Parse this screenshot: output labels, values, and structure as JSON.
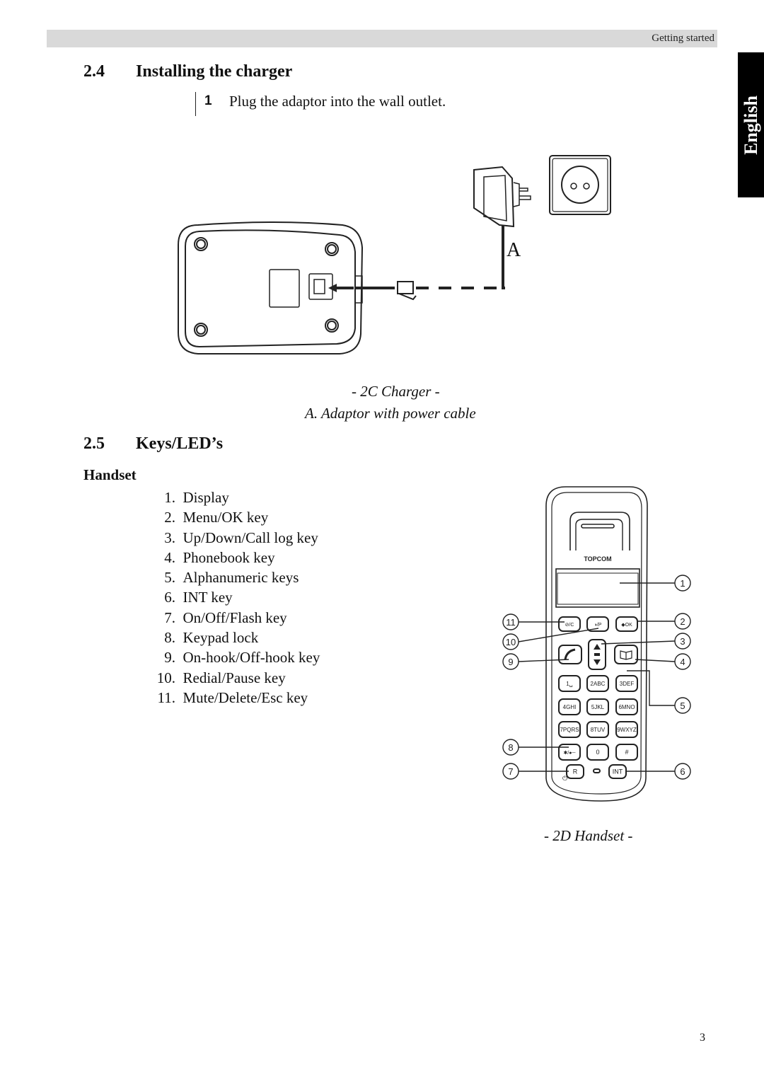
{
  "header": {
    "section_label": "Getting started"
  },
  "language_tab": "English",
  "section_charger": {
    "number": "2.4",
    "title": "Installing the charger",
    "step": {
      "number": "1",
      "text": "Plug the adaptor into the wall outlet."
    },
    "figure": {
      "label_A": "A",
      "caption_title": "- 2C Charger -",
      "caption_legend": "A.  Adaptor with power cable"
    }
  },
  "section_keys": {
    "number": "2.5",
    "title": "Keys/LED’s",
    "subheading": "Handset",
    "items": [
      {
        "num": "1.",
        "label": "Display"
      },
      {
        "num": "2.",
        "label": "Menu/OK key"
      },
      {
        "num": "3.",
        "label": "Up/Down/Call log key"
      },
      {
        "num": "4.",
        "label": "Phonebook key"
      },
      {
        "num": "5.",
        "label": "Alphanumeric keys"
      },
      {
        "num": "6.",
        "label": "INT key"
      },
      {
        "num": "7.",
        "label": "On/Off/Flash key"
      },
      {
        "num": "8.",
        "label": "Keypad lock"
      },
      {
        "num": "9.",
        "label": "On-hook/Off-hook key"
      },
      {
        "num": "10.",
        "label": "Redial/Pause key"
      },
      {
        "num": "11.",
        "label": "Mute/Delete/Esc key"
      }
    ],
    "handset_figure": {
      "brand": "TOPCOM",
      "callouts": [
        "1",
        "2",
        "3",
        "4",
        "5",
        "6",
        "7",
        "8",
        "9",
        "10",
        "11"
      ],
      "keys": {
        "mute": "⊘/C",
        "redial": "◑/P",
        "menu": "◆OK",
        "digits": [
          "1␣",
          "2ABC",
          "3DEF",
          "4GHI",
          "5JKL",
          "6MNO",
          "7PQRS",
          "8TUV",
          "9WXYZ"
        ],
        "star": "✱/●─",
        "zero": "0",
        "hash": "#",
        "r": "R",
        "int": "INT"
      },
      "caption": "- 2D Handset -"
    }
  },
  "footer": {
    "page_number": "3"
  }
}
